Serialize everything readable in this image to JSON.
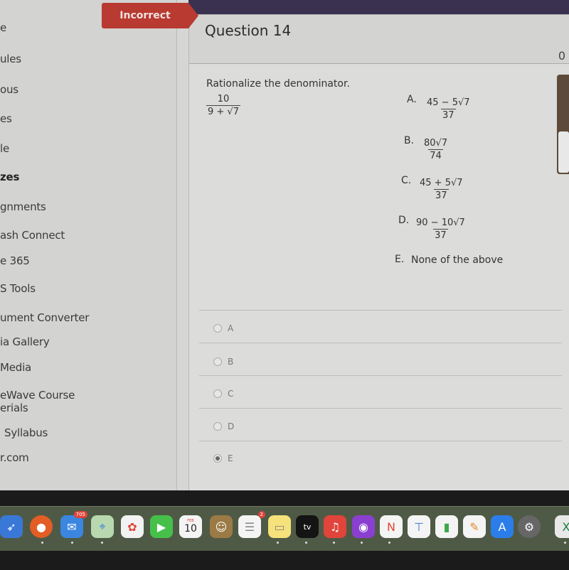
{
  "sidebar": {
    "items": [
      {
        "label": "e"
      },
      {
        "label": "ules"
      },
      {
        "label": "ous"
      },
      {
        "label": "es"
      },
      {
        "label": "le"
      },
      {
        "label": "zes"
      },
      {
        "label": "gnments"
      },
      {
        "label": "ash Connect"
      },
      {
        "label": "e 365"
      },
      {
        "label": "S Tools"
      },
      {
        "label": "ument Converter"
      },
      {
        "label": "ia Gallery"
      },
      {
        "label": "Media"
      },
      {
        "label": "eWave Course\nerials"
      },
      {
        "label": "Syllabus"
      },
      {
        "label": "r.com"
      }
    ]
  },
  "question": {
    "status_badge": "Incorrect",
    "title": "Question 14",
    "points": "0",
    "prompt": "Rationalize the denominator.",
    "expression": {
      "numerator": "10",
      "denominator": "9 + √7"
    },
    "choices": [
      {
        "letter": "A.",
        "numerator": "45 − 5√7",
        "denominator": "37"
      },
      {
        "letter": "B.",
        "numerator": "80√7",
        "denominator": "74"
      },
      {
        "letter": "C.",
        "numerator": "45 + 5√7",
        "denominator": "37"
      },
      {
        "letter": "D.",
        "numerator": "90 − 10√7",
        "denominator": "37"
      },
      {
        "letter": "E.",
        "text": "None of the above"
      }
    ],
    "answers": [
      {
        "label": "A",
        "selected": false
      },
      {
        "label": "B",
        "selected": false
      },
      {
        "label": "C",
        "selected": false
      },
      {
        "label": "D",
        "selected": false
      },
      {
        "label": "E",
        "selected": true
      }
    ]
  },
  "dock": {
    "items": [
      {
        "name": "Safari",
        "icon": "compass"
      },
      {
        "name": "Firefox",
        "icon": "firefox"
      },
      {
        "name": "Mail",
        "icon": "envelope",
        "badge": "705"
      },
      {
        "name": "Maps",
        "icon": "map"
      },
      {
        "name": "Photos",
        "icon": "flower"
      },
      {
        "name": "FaceTime",
        "icon": "video-camera"
      },
      {
        "name": "Calendar",
        "icon": "calendar",
        "month": "FEB",
        "day": "10"
      },
      {
        "name": "Contacts",
        "icon": "contact"
      },
      {
        "name": "Reminders",
        "icon": "list",
        "badge": "2"
      },
      {
        "name": "Notes",
        "icon": "notes"
      },
      {
        "name": "TV",
        "icon": "tv",
        "label": "tv"
      },
      {
        "name": "Music",
        "icon": "music-note"
      },
      {
        "name": "Podcasts",
        "icon": "podcast"
      },
      {
        "name": "News",
        "icon": "news"
      },
      {
        "name": "Keynote",
        "icon": "podium"
      },
      {
        "name": "Numbers",
        "icon": "bar-chart"
      },
      {
        "name": "Pages",
        "icon": "pen"
      },
      {
        "name": "App Store",
        "icon": "app-store"
      },
      {
        "name": "System Settings",
        "icon": "gear"
      },
      {
        "name": "Excel",
        "icon": "excel"
      }
    ]
  }
}
